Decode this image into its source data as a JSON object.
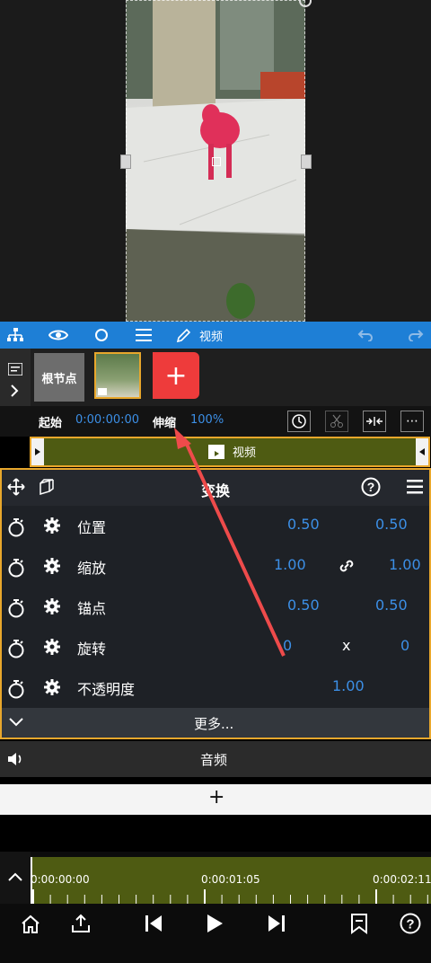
{
  "toolbar": {
    "mode_label": "视频"
  },
  "nodes": {
    "root_label": "根节点",
    "add_label": "+"
  },
  "info": {
    "start_label": "起始",
    "start_value": "0:00:00:00",
    "stretch_label": "伸缩",
    "stretch_value": "100%"
  },
  "track": {
    "label": "视频"
  },
  "transform": {
    "title": "变换",
    "rows": [
      {
        "label": "位置",
        "v1": "0.50",
        "v2": "0.50"
      },
      {
        "label": "缩放",
        "v1": "1.00",
        "v2": "1.00"
      },
      {
        "label": "锚点",
        "v1": "0.50",
        "v2": "0.50"
      },
      {
        "label": "旋转",
        "v1": "0",
        "sep": "x",
        "v2": "0"
      },
      {
        "label": "不透明度",
        "v1": "1.00"
      }
    ],
    "more_label": "更多..."
  },
  "audio": {
    "label": "音频"
  },
  "add_layer": {
    "label": "+"
  },
  "timeline": {
    "t0": "0:00:00:00",
    "t1": "0:00:01:05",
    "t2": "0:00:02:11"
  },
  "colors": {
    "accent": "#1e7fd6",
    "highlight": "#e8a72c",
    "value_blue": "#3c8fe6",
    "add_red": "#ee3b3b",
    "track_olive": "#4e5b12"
  }
}
